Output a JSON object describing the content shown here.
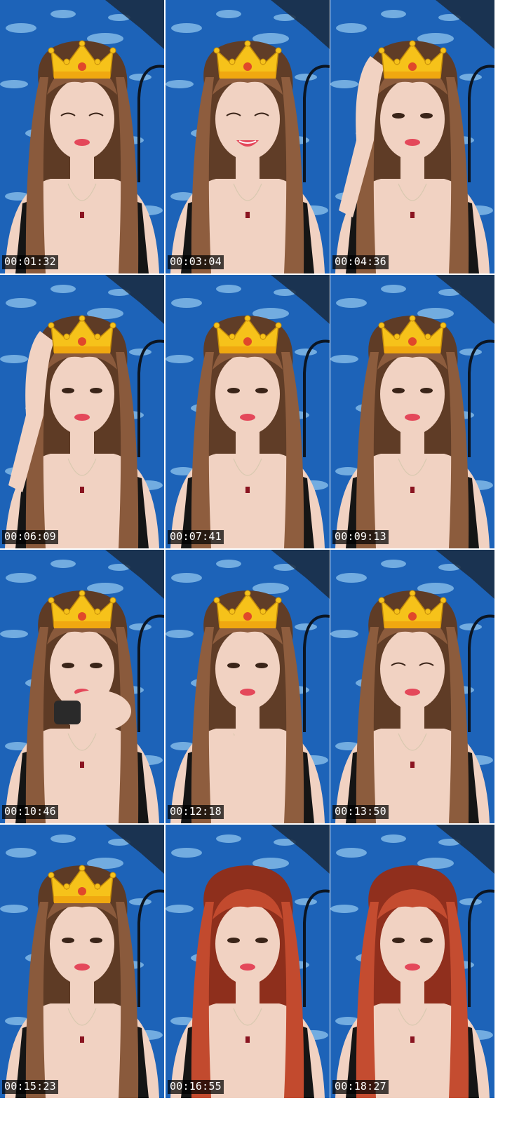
{
  "frames": [
    {
      "time": "00:01:32",
      "hair": "#8a5a3c",
      "hair_dark": "#5e3b25",
      "crown": true,
      "pose": "closed"
    },
    {
      "time": "00:03:04",
      "hair": "#8e5d3e",
      "hair_dark": "#603d27",
      "crown": true,
      "pose": "smile"
    },
    {
      "time": "00:04:36",
      "hair": "#8c5c3d",
      "hair_dark": "#5f3c26",
      "crown": true,
      "pose": "hand"
    },
    {
      "time": "00:06:09",
      "hair": "#8a5a3c",
      "hair_dark": "#5e3b25",
      "crown": true,
      "pose": "hand"
    },
    {
      "time": "00:07:41",
      "hair": "#8e5d3e",
      "hair_dark": "#603d27",
      "crown": true,
      "pose": "talk"
    },
    {
      "time": "00:09:13",
      "hair": "#8c5c3d",
      "hair_dark": "#5f3c26",
      "crown": true,
      "pose": "neutral"
    },
    {
      "time": "00:10:46",
      "hair": "#8a5a3c",
      "hair_dark": "#5e3b25",
      "crown": true,
      "pose": "object"
    },
    {
      "time": "00:12:18",
      "hair": "#8e5d3e",
      "hair_dark": "#603d27",
      "crown": true,
      "pose": "wave"
    },
    {
      "time": "00:13:50",
      "hair": "#8c5c3d",
      "hair_dark": "#5f3c26",
      "crown": true,
      "pose": "closed"
    },
    {
      "time": "00:15:23",
      "hair": "#8a5a3c",
      "hair_dark": "#5e3b25",
      "crown": true,
      "pose": "neutral"
    },
    {
      "time": "00:16:55",
      "hair": "#c24a2e",
      "hair_dark": "#8e2f1c",
      "crown": false,
      "pose": "neutral"
    },
    {
      "time": "00:18:27",
      "hair": "#c44c30",
      "hair_dark": "#902f1d",
      "crown": false,
      "pose": "neutral"
    }
  ],
  "colors": {
    "background_blue": "#1d63b8",
    "cloud": "#8fc4ee",
    "wall_dark": "#1a2a3e",
    "skin": "#f1d2c2",
    "lips": "#e4485a",
    "crown_gold": "#f6c21a",
    "crown_jewel": "#e0482a",
    "stamp_bg": "#000000",
    "stamp_text": "#ffffff"
  }
}
